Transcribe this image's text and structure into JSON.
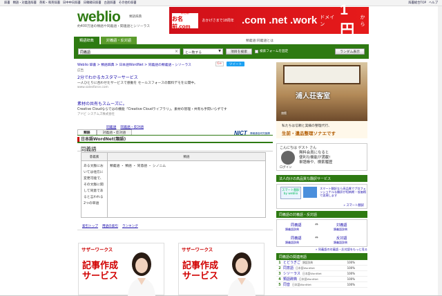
{
  "topbar": {
    "links": [
      "辞書",
      "類語・対義語辞書",
      "英和・和英辞書",
      "日中中日辞書",
      "日韓韓日辞書",
      "古語辞書",
      "その他の辞書"
    ],
    "right_links": [
      "辞書総合TOP",
      "ヘルプ"
    ]
  },
  "header": {
    "logo": "weblio",
    "logo_sub": "類語辞典",
    "tagline": "約400万語の類語や同義語・関連語とシソーラス"
  },
  "ad_banner": {
    "brand_top": "お名前",
    "brand_bottom": "お名前.com",
    "promo": "おかげさまで18周年",
    "domains": ".com .net .work",
    "label": "ドメイン",
    "price": "1円",
    "yen": "から"
  },
  "tabs": [
    {
      "label": "類語辞典",
      "active": true
    },
    {
      "label": "対義語・反対語",
      "active": false
    }
  ],
  "tabs_info": "類義語:同義語とは",
  "search": {
    "value": "同義語",
    "clear": "×",
    "mode": "と一致する",
    "mode_arrow": "▼",
    "search_btn": "項目を検索",
    "checkbox_label": "検索フォームを固定",
    "random_btn": "ランダム表示"
  },
  "breadcrumb": "Weblio 辞書 > 類語辞典 > 日本語WordNet > 同義語の類義語・シソーラス",
  "social": {
    "gplus": "G+",
    "tweet": "ツイート"
  },
  "ads": {
    "label": "広告",
    "ad1_title": "2分でわかるカスタマーサービス",
    "ad1_text": "一人ひとりに合わせたサービスで感動を セールスフォースの無料デモを公開中。",
    "ad1_url": "www.salesforce.com",
    "ad2_title": "素材の共有もスムーズに。",
    "ad2_text": "Creative Cloudならではの機能「Creative Cloudライブラリ」。素材の管理・共有も手間いらずです",
    "ad2_url": "アドビ システムズ株式会社"
  },
  "synlinks": [
    "同義語",
    "同義語・反対語"
  ],
  "subtabs": [
    "類語",
    "対義語・反対語"
  ],
  "source": {
    "title": "日本語WordNet(類語)",
    "nict": "NICT",
    "nict_sub": "情報通信研究機構"
  },
  "word": "同義語",
  "table": {
    "headers": [
      "意義素",
      "類語"
    ],
    "meaning": "ある文脈においては他方に変更可能で、その文脈に関して同意であると言われる2つの単語",
    "synonyms": "類義語 ・ 類語 ・ 同意語 ・ シノニム"
  },
  "bottom_links": [
    "索引トップ",
    "用語の索引",
    "ランキング"
  ],
  "display_ads": [
    {
      "brand": "サザーワークス",
      "headline": "記事作成サービス"
    },
    {
      "brand": "サザーワークス",
      "headline": "記事作成サービス"
    }
  ],
  "right": {
    "photo_kanji": "浦人荘客室",
    "photo_badge": "旅館",
    "photo_caption_1": "私たちは信頼と実績の整理代行、",
    "photo_caption_2": "生前・遺品整理ソナエです",
    "hello": "こんにちは ゲスト さん",
    "login_btn": "ログイン",
    "login_msg": [
      "無料会員になると",
      "便利な機能が満載!",
      "単語帳や、検索履歴",
      "を管理しよう"
    ],
    "login_arrow": "▶",
    "trans_title": "法人向けの高品質な翻訳サービス",
    "trans_logo": "スマート翻訳 by weblio",
    "trans_text": "スマート翻訳なら高品質でプロフェッショナルな翻訳が短納期・低価格で実現します",
    "trans_more": "» スマート翻訳",
    "ant_title": "同義語の対義語・反対語",
    "antonyms": [
      {
        "w1": "同義語",
        "w2": "対義語",
        "s1": "類義語辞典",
        "s2": "類義語辞典"
      },
      {
        "w1": "同義語",
        "w2": "反対語",
        "s1": "類義語辞典",
        "s2": "類義語辞典"
      }
    ],
    "ant_arrow": "⇔",
    "ant_more": "» 同義語の対義語・反対語をもっと見る",
    "rank_title": "同義語の関連用語",
    "ranks": [
      {
        "n": "1",
        "w": "とどうぎご",
        "d": "類語辞典",
        "p": "100%"
      },
      {
        "n": "2",
        "w": "同意語",
        "d": "日本語WordNet",
        "p": "100%"
      },
      {
        "n": "3",
        "w": "シソーラス",
        "d": "日本語WordNet",
        "p": "100%"
      },
      {
        "n": "4",
        "w": "類語辞典",
        "d": "日本語WordNet",
        "p": "100%"
      },
      {
        "n": "5",
        "w": "同音",
        "d": "日本語WordNet",
        "p": "100%"
      }
    ]
  },
  "colors": {
    "brand_green": "#2e7a12",
    "ad_red": "#d10000",
    "link_blue": "#1a0dab"
  }
}
